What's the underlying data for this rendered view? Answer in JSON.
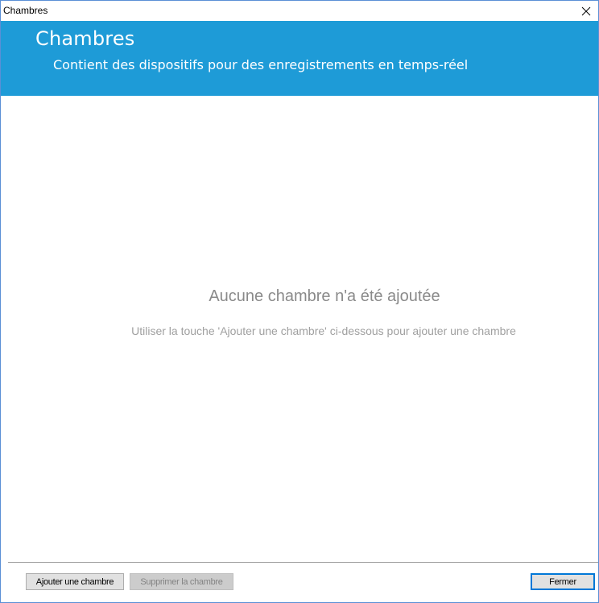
{
  "window": {
    "title": "Chambres",
    "close_glyph": "✕"
  },
  "header": {
    "title": "Chambres",
    "subtitle": "Contient des dispositifs pour des enregistrements en temps-réel",
    "background_color": "#1e9bd7"
  },
  "content": {
    "empty_title": "Aucune chambre n'a été ajoutée",
    "empty_hint": "Utiliser la touche 'Ajouter une chambre' ci-dessous pour ajouter une chambre"
  },
  "footer": {
    "add_label": "Ajouter une chambre",
    "remove_label": "Supprimer la chambre",
    "close_label": "Fermer"
  },
  "icons": {
    "close": "close-icon"
  }
}
